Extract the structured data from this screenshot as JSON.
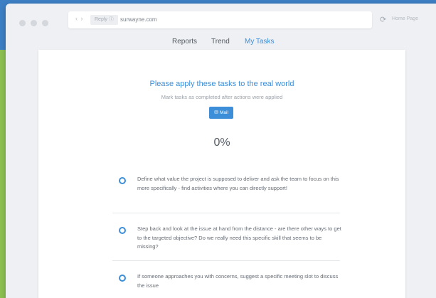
{
  "browser": {
    "url_chip": "Reply ⓘ",
    "url": "surwayne.com",
    "home_label": "Home Page"
  },
  "tabs": [
    {
      "label": "Reports",
      "active": false
    },
    {
      "label": "Trend",
      "active": false
    },
    {
      "label": "My Tasks",
      "active": true
    }
  ],
  "main": {
    "title": "Please apply these tasks to the real world",
    "subtitle": "Mark tasks as completed after actions were applied",
    "mail_button_label": "Mail",
    "progress": "0%"
  },
  "tasks": [
    {
      "text": "Define what value the project is supposed to deliver and ask the team to focus on this more specifically - find activities where you can directly support!",
      "completed": false
    },
    {
      "text": "Step back and look at the issue at hand from the distance - are there other ways to get to the targeted objective? Do we really need this specific skill that seems to be missing?",
      "completed": false
    },
    {
      "text": "If someone approaches you with concerns, suggest a specific meeting slot to discuss the issue",
      "completed": false
    }
  ],
  "colors": {
    "accent": "#3d8ed8",
    "background": "#3d7fc4",
    "side_strip": "#8cc152"
  },
  "icons": {
    "reload": "reload-icon",
    "mail": "mail-icon",
    "task_status": "circle-outline-icon"
  }
}
